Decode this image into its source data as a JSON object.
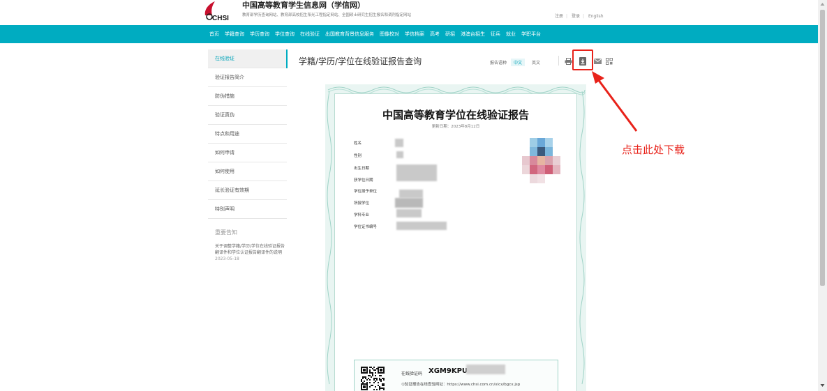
{
  "header": {
    "site_title": "中国高等教育学生信息网（学信网）",
    "logo_text": "CHSI",
    "subtitle": "教育部学历查询网站、教育部高校招生阳光工程指定网站、全国硕士研究生招生报名和调剂指定网站",
    "links": {
      "register": "注册",
      "login": "登录",
      "english": "English"
    }
  },
  "nav": {
    "items": [
      "首页",
      "学籍查询",
      "学历查询",
      "学位查询",
      "在线验证",
      "出国教育背景信息服务",
      "图像校对",
      "学信档案",
      "高考",
      "研招",
      "港澳台招生",
      "征兵",
      "就业",
      "学职平台"
    ]
  },
  "sidebar": {
    "items": [
      {
        "label": "在线验证",
        "active": true
      },
      {
        "label": "验证报告简介",
        "active": false
      },
      {
        "label": "防伪措施",
        "active": false
      },
      {
        "label": "验证真伪",
        "active": false
      },
      {
        "label": "特点和用途",
        "active": false
      },
      {
        "label": "如何申请",
        "active": false
      },
      {
        "label": "如何使用",
        "active": false
      },
      {
        "label": "延长验证有效期",
        "active": false
      },
      {
        "label": "特别声明",
        "active": false
      }
    ],
    "notice": {
      "title": "重要告知",
      "text": "关于调整学籍/学历/学位在线验证报告翻译件和学位认证报告翻译件的说明",
      "date": "2023-05-18"
    }
  },
  "main": {
    "title": "学籍/学历/学位在线验证报告查询",
    "language_label": "报告语种",
    "lang_options": [
      "中文",
      "英文"
    ],
    "selected_lang": "中文",
    "toolbar_icons": [
      "print-icon",
      "download-icon",
      "mail-icon",
      "qrcode-icon"
    ]
  },
  "certificate": {
    "title": "中国高等教育学位在线验证报告",
    "updated": "更新日期：2023年8月12日",
    "fields": [
      "姓名",
      "性别",
      "出生日期",
      "获学位日期",
      "学位授予单位",
      "所授学位",
      "学科专业",
      "学位证书编号"
    ],
    "verify_label": "在线验证码",
    "verify_code": "XGM9KPU",
    "verify_url_text": "①验证报告在线查验网址：https://www.chsi.com.cn/xlcx/bgcx.jsp"
  },
  "annotation": {
    "text": "点击此处下载",
    "color": "#e8221a"
  },
  "colors": {
    "nav_bg": "#00acc1",
    "accent": "#00a3b8",
    "annotation_red": "#e8221a"
  }
}
